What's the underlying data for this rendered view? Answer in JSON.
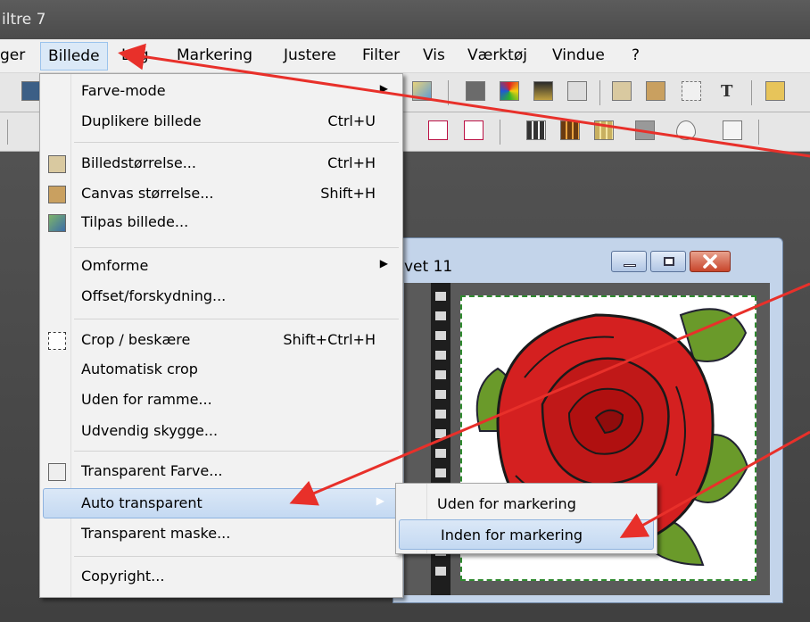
{
  "window": {
    "title": "iltre 7"
  },
  "menubar": {
    "items": [
      "ger",
      "Billede",
      "Lag",
      "Markering",
      "Justere",
      "Filter",
      "Vis",
      "Værktøj",
      "Vindue",
      "?"
    ]
  },
  "toolbar": {
    "text_tool": "T"
  },
  "image_window": {
    "title": "vet 11"
  },
  "billede_menu": {
    "items": [
      {
        "label": "Farve-mode",
        "shortcut": "",
        "submenu": true,
        "icon": ""
      },
      {
        "label": "Duplikere billede",
        "shortcut": "Ctrl+U",
        "submenu": false,
        "icon": ""
      },
      {
        "label": "Billedstørrelse...",
        "shortcut": "Ctrl+H",
        "submenu": false,
        "icon": "image-size-icon"
      },
      {
        "label": "Canvas størrelse...",
        "shortcut": "Shift+H",
        "submenu": false,
        "icon": "canvas-size-icon"
      },
      {
        "label": "Tilpas billede...",
        "shortcut": "",
        "submenu": false,
        "icon": "fit-image-icon"
      },
      {
        "label": "Omforme",
        "shortcut": "",
        "submenu": true,
        "icon": ""
      },
      {
        "label": "Offset/forskydning...",
        "shortcut": "",
        "submenu": false,
        "icon": ""
      },
      {
        "label": "Crop / beskære",
        "shortcut": "Shift+Ctrl+H",
        "submenu": false,
        "icon": "crop-icon"
      },
      {
        "label": "Automatisk crop",
        "shortcut": "",
        "submenu": false,
        "icon": ""
      },
      {
        "label": "Uden for ramme...",
        "shortcut": "",
        "submenu": false,
        "icon": ""
      },
      {
        "label": "Udvendig skygge...",
        "shortcut": "",
        "submenu": false,
        "icon": ""
      },
      {
        "label": "Transparent Farve...",
        "shortcut": "",
        "submenu": false,
        "icon": "transparent-color-icon"
      },
      {
        "label": "Auto transparent",
        "shortcut": "",
        "submenu": true,
        "icon": "",
        "highlighted": true
      },
      {
        "label": "Transparent maske...",
        "shortcut": "",
        "submenu": false,
        "icon": ""
      },
      {
        "label": "Copyright...",
        "shortcut": "",
        "submenu": false,
        "icon": ""
      }
    ]
  },
  "auto_transparent_submenu": {
    "items": [
      {
        "label": "Uden for markering",
        "highlighted": false
      },
      {
        "label": "Inden for markering",
        "highlighted": true
      }
    ]
  },
  "colors": {
    "menu_bg": "#f2f2f2",
    "highlight": "#c4d9f2",
    "annotation_arrow": "#e8302a",
    "rose": "#d42020",
    "leaf": "#6a9a2a",
    "workspace": "#4a4a4a"
  }
}
